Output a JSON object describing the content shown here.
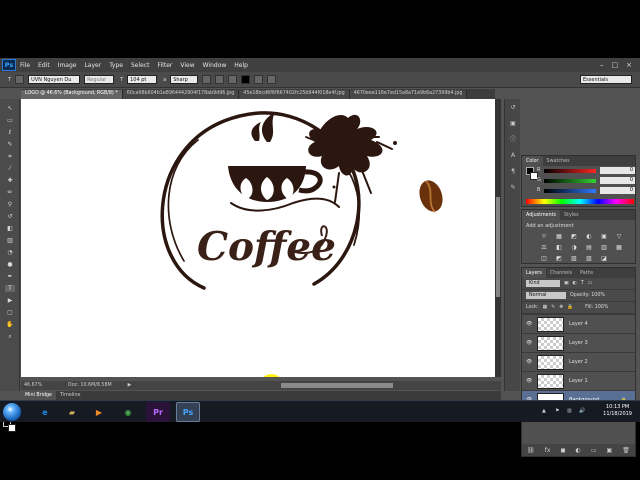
{
  "photoshop": {
    "logo_label": "Ps",
    "menu": [
      "File",
      "Edit",
      "Image",
      "Layer",
      "Type",
      "Select",
      "Filter",
      "View",
      "Window",
      "Help"
    ],
    "window_controls": [
      "–",
      "□",
      "×"
    ],
    "options": {
      "font": "UVN Nguyen Du",
      "style": "Regular",
      "size": "104 pt",
      "antialias": "Sharp",
      "workspace": "Essentials"
    },
    "tabs": [
      "LOGO @ 46.6% (Background, RGB/8) *",
      "60ca98b604b1e8964442904f178ab9d96.jpg",
      "45e18bcd6f6f667402fc25b944f018e4f.jpg",
      "4670eee116e7ed15a8a71e9b6a27399b4.jpg"
    ],
    "status": {
      "zoom": "46.67%",
      "doc": "Doc: 10.6M/8.58M"
    },
    "bottom_tabs": [
      "Mini Bridge",
      "Timeline"
    ],
    "color_panel": {
      "tabs": [
        "Color",
        "Swatches"
      ],
      "channels": [
        {
          "label": "R",
          "value": "0",
          "color": "#d32121"
        },
        {
          "label": "G",
          "value": "0",
          "color": "#34ba34"
        },
        {
          "label": "B",
          "value": "0",
          "color": "#296fe7"
        }
      ]
    },
    "adjustments": {
      "tabs": [
        "Adjustments",
        "Styles"
      ],
      "title": "Add an adjustment",
      "icons": [
        "☼",
        "▦",
        "◩",
        "◐",
        "▣",
        "▽",
        "⚖",
        "◧",
        "◑",
        "▤",
        "▥",
        "▦",
        "◫",
        "◩",
        "▨",
        "▧",
        "◪"
      ]
    },
    "layers": {
      "tabs": [
        "Layers",
        "Channels",
        "Paths"
      ],
      "kind": "Kind",
      "blend": "Normal",
      "opacity": "Opacity: 100%",
      "lock": "Lock:",
      "fill": "Fill: 100%",
      "items": [
        {
          "name": "Layer 4",
          "thumbnail": "checker"
        },
        {
          "name": "Layer 3",
          "thumbnail": "checker"
        },
        {
          "name": "Layer 2",
          "thumbnail": "checker"
        },
        {
          "name": "Layer 1",
          "thumbnail": "checker"
        },
        {
          "name": "Background",
          "thumbnail": "white",
          "selected": true,
          "locked": true
        }
      ],
      "footer_icons": [
        "⛓",
        "fx",
        "◼",
        "◐",
        "▭",
        "▣",
        "🗑"
      ]
    }
  },
  "canvas": {
    "logo_text": "Coffee",
    "cursor_highlight": "#ffef00"
  },
  "taskbar": {
    "apps": [
      {
        "name": "internet-explorer",
        "glyph": "e",
        "color": "#1a8ee8"
      },
      {
        "name": "file-explorer",
        "glyph": "▰",
        "color": "#d1b35a"
      },
      {
        "name": "media-player",
        "glyph": "▶",
        "color": "#f08a2b"
      },
      {
        "name": "chrome",
        "glyph": "◉",
        "color": "#4caf50"
      },
      {
        "name": "premiere",
        "glyph": "Pr",
        "color": "#8b42c4"
      },
      {
        "name": "photoshop",
        "glyph": "Ps",
        "color": "#2b7bd8",
        "active": true
      }
    ],
    "time": "10:13 PM",
    "date": "11/18/2019"
  }
}
